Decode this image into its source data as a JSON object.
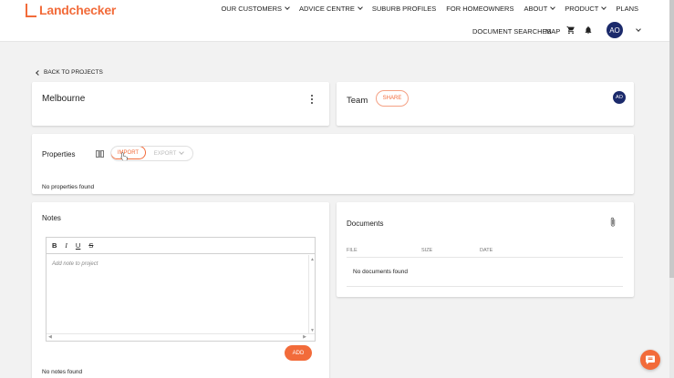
{
  "brand": {
    "name": "Landchecker",
    "accent": "#f26b3a",
    "avatar_color": "#1b2a6b"
  },
  "nav": {
    "primary": [
      {
        "label": "OUR CUSTOMERS",
        "dropdown": true
      },
      {
        "label": "ADVICE CENTRE",
        "dropdown": true
      },
      {
        "label": "SUBURB PROFILES",
        "dropdown": false
      },
      {
        "label": "FOR HOMEOWNERS",
        "dropdown": false
      },
      {
        "label": "ABOUT",
        "dropdown": true
      },
      {
        "label": "PRODUCT",
        "dropdown": true
      },
      {
        "label": "PLANS",
        "dropdown": false
      }
    ],
    "secondary": {
      "document_searches": "DOCUMENT SEARCHES",
      "map": "MAP",
      "cart_icon": "cart-icon",
      "bell_icon": "bell-icon",
      "user_initials": "AO"
    }
  },
  "back_link": "BACK TO PROJECTS",
  "project": {
    "name": "Melbourne",
    "menu_icon": "more-vert-icon"
  },
  "team": {
    "title": "Team",
    "share_label": "SHARE",
    "member_initials": "AO"
  },
  "properties": {
    "title": "Properties",
    "map_icon": "map-icon",
    "import_label": "IMPORT",
    "export_label": "EXPORT",
    "empty_text": "No properties found"
  },
  "notes": {
    "title": "Notes",
    "toolbar": {
      "bold": "B",
      "italic": "I",
      "underline": "U",
      "strike": "S"
    },
    "placeholder": "Add note to project",
    "add_label": "ADD",
    "empty_text": "No notes found"
  },
  "documents": {
    "title": "Documents",
    "attach_icon": "paperclip-icon",
    "columns": [
      "FILE",
      "SIZE",
      "DATE"
    ],
    "empty_text": "No documents found"
  },
  "chat_icon": "chat-icon"
}
